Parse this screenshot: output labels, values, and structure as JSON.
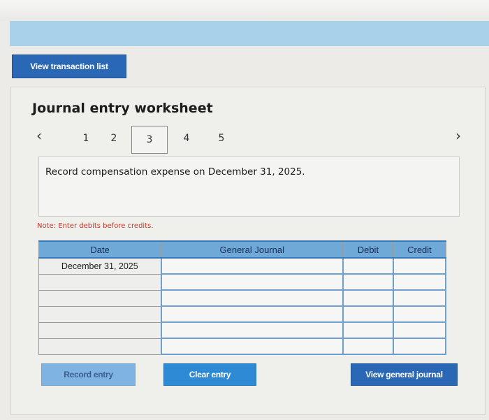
{
  "header": {
    "view_transactions_label": "View transaction list"
  },
  "worksheet": {
    "title": "Journal entry worksheet",
    "pages": [
      "1",
      "2",
      "3",
      "4",
      "5"
    ],
    "active_page": "3",
    "prev_icon": "‹",
    "next_icon": "›",
    "prompt": "Record compensation expense on December 31, 2025.",
    "note": "Note: Enter debits before credits."
  },
  "table": {
    "headers": {
      "date": "Date",
      "general_journal": "General Journal",
      "debit": "Debit",
      "credit": "Credit"
    },
    "rows": [
      {
        "date": "December 31, 2025",
        "account": "",
        "debit": "",
        "credit": ""
      },
      {
        "date": "",
        "account": "",
        "debit": "",
        "credit": ""
      },
      {
        "date": "",
        "account": "",
        "debit": "",
        "credit": ""
      },
      {
        "date": "",
        "account": "",
        "debit": "",
        "credit": ""
      },
      {
        "date": "",
        "account": "",
        "debit": "",
        "credit": ""
      },
      {
        "date": "",
        "account": "",
        "debit": "",
        "credit": ""
      }
    ]
  },
  "buttons": {
    "record_entry": "Record entry",
    "clear_entry": "Clear entry",
    "view_general_journal": "View general journal"
  },
  "colors": {
    "primary_button": "#2a67b5",
    "header_band": "#a9d1ea",
    "table_header": "#6ea9d8",
    "note_text": "#c0392b"
  }
}
